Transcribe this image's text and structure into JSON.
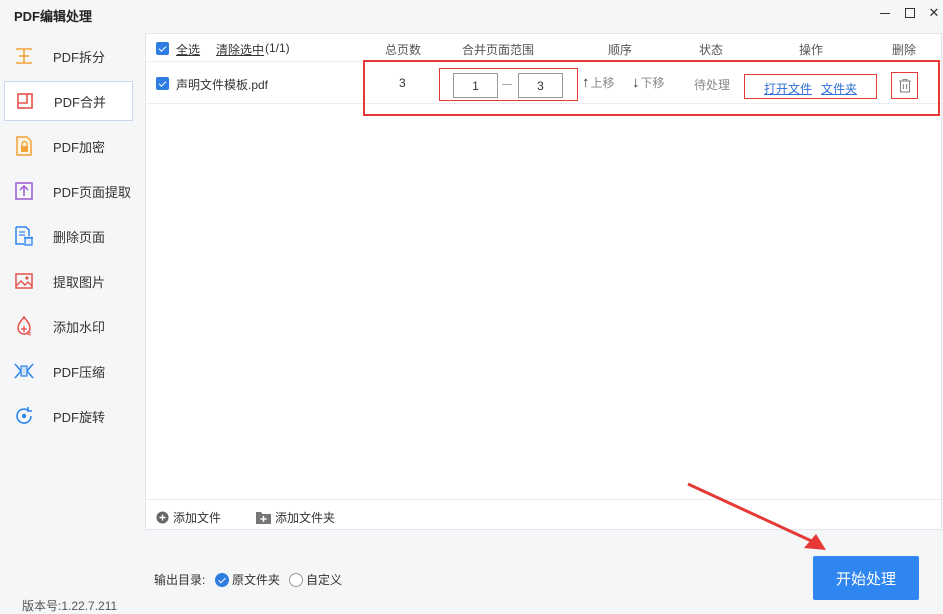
{
  "app": {
    "title": "PDF编辑处理",
    "version": "版本号:1.22.7.211"
  },
  "sidebar": {
    "items": [
      {
        "label": "PDF拆分",
        "icon": "split-icon",
        "active": false
      },
      {
        "label": "PDF合并",
        "icon": "merge-icon",
        "active": true
      },
      {
        "label": "PDF加密",
        "icon": "lock-icon",
        "active": false
      },
      {
        "label": "PDF页面提取",
        "icon": "extract-page-icon",
        "active": false
      },
      {
        "label": "删除页面",
        "icon": "delete-page-icon",
        "active": false
      },
      {
        "label": "提取图片",
        "icon": "extract-image-icon",
        "active": false
      },
      {
        "label": "添加水印",
        "icon": "watermark-icon",
        "active": false
      },
      {
        "label": "PDF压缩",
        "icon": "compress-icon",
        "active": false
      },
      {
        "label": "PDF旋转",
        "icon": "rotate-icon",
        "active": false
      }
    ]
  },
  "table": {
    "select_all": "全选",
    "clear_selection": "清除选中",
    "selection_count": "(1/1)",
    "columns": {
      "total_pages": "总页数",
      "page_range": "合并页面范围",
      "order": "顺序",
      "status": "状态",
      "actions": "操作",
      "delete": "删除"
    },
    "rows": [
      {
        "checked": true,
        "filename": "声明文件模板.pdf",
        "total_pages": "3",
        "range_start": "1",
        "range_end": "3",
        "move_up": "上移",
        "move_down": "下移",
        "status": "待处理",
        "open_file": "打开文件",
        "open_folder": "文件夹"
      }
    ]
  },
  "footer": {
    "add_file": "添加文件",
    "add_folder": "添加文件夹"
  },
  "output": {
    "label": "输出目录:",
    "option_source": "原文件夹",
    "option_custom": "自定义",
    "selected": "原文件夹"
  },
  "start_button": "开始处理",
  "colors": {
    "accent": "#2f86f0",
    "highlight": "#e53935"
  }
}
